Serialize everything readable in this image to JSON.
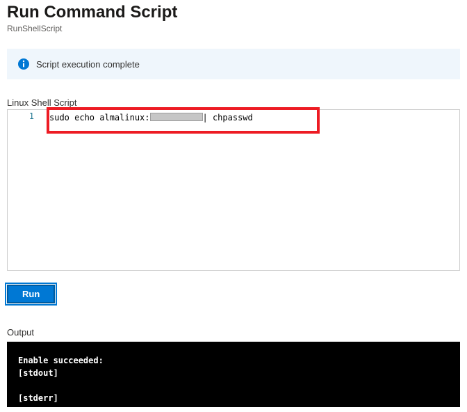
{
  "header": {
    "title": "Run Command Script",
    "subtitle": "RunShellScript"
  },
  "banner": {
    "message": "Script execution complete"
  },
  "editor": {
    "label": "Linux Shell Script",
    "line_number": "1",
    "code_prefix": "sudo echo almalinux:",
    "code_suffix": "| chpasswd"
  },
  "actions": {
    "run_label": "Run"
  },
  "output": {
    "label": "Output",
    "text": "Enable succeeded:\n[stdout]\n\n[stderr]"
  }
}
